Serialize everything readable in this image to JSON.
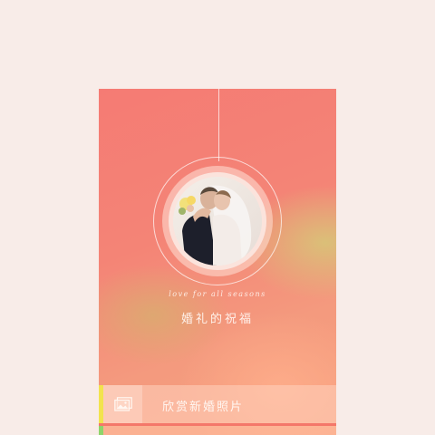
{
  "card": {
    "tagline": "love for all seasons",
    "title": "婚礼的祝福"
  },
  "menu": {
    "items": [
      {
        "label": "欣赏新婚照片",
        "icon": "photo-gallery-icon",
        "accent": "#f2e34e"
      },
      {
        "label": "",
        "icon": "",
        "accent": "#8fd46a"
      }
    ]
  },
  "colors": {
    "page_background": "#f8ece8",
    "card_gradient_top": "#f57b74",
    "card_gradient_bottom": "#f7a17f",
    "divider": "#f4776a"
  }
}
